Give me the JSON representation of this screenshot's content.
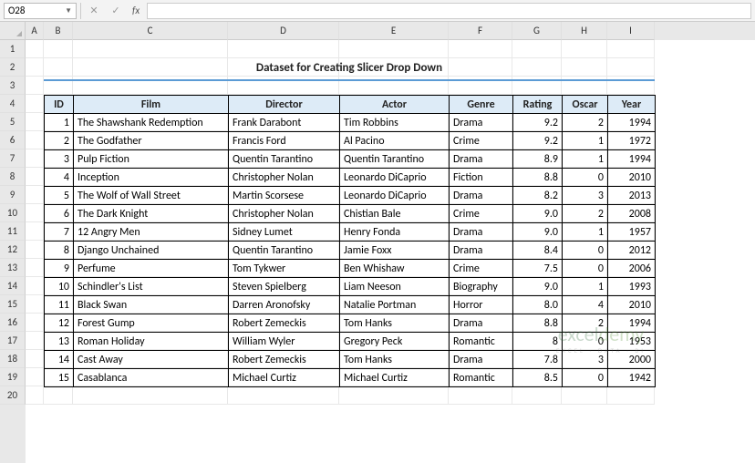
{
  "nameBox": {
    "value": "O28"
  },
  "formulaBar": {
    "value": ""
  },
  "title": "Dataset for Creating Slicer Drop Down",
  "columns": [
    "A",
    "B",
    "C",
    "D",
    "E",
    "F",
    "G",
    "H",
    "I"
  ],
  "rows": [
    1,
    2,
    3,
    4,
    5,
    6,
    7,
    8,
    9,
    10,
    11,
    12,
    13,
    14,
    15,
    16,
    17,
    18,
    19,
    20
  ],
  "headers": {
    "id": "ID",
    "film": "Film",
    "director": "Director",
    "actor": "Actor",
    "genre": "Genre",
    "rating": "Rating",
    "oscar": "Oscar",
    "year": "Year"
  },
  "chart_data": {
    "type": "table",
    "title": "Dataset for Creating Slicer Drop Down",
    "columns": [
      "ID",
      "Film",
      "Director",
      "Actor",
      "Genre",
      "Rating",
      "Oscar",
      "Year"
    ],
    "rows": [
      {
        "id": "1",
        "film": "The Shawshank Redemption",
        "director": "Frank Darabont",
        "actor": "Tim Robbins",
        "genre": "Drama",
        "rating": "9.2",
        "oscar": "2",
        "year": "1994"
      },
      {
        "id": "2",
        "film": "The Godfather",
        "director": "Francis Ford",
        "actor": "Al Pacino",
        "genre": "Crime",
        "rating": "9.2",
        "oscar": "1",
        "year": "1972"
      },
      {
        "id": "3",
        "film": "Pulp Fiction",
        "director": "Quentin Tarantino",
        "actor": "Quentin Tarantino",
        "genre": "Drama",
        "rating": "8.9",
        "oscar": "1",
        "year": "1994"
      },
      {
        "id": "4",
        "film": "Inception",
        "director": "Christopher Nolan",
        "actor": "Leonardo DiCaprio",
        "genre": "Fiction",
        "rating": "8.8",
        "oscar": "0",
        "year": "2010"
      },
      {
        "id": "5",
        "film": "The Wolf of Wall Street",
        "director": "Martin Scorsese",
        "actor": "Leonardo DiCaprio",
        "genre": "Drama",
        "rating": "8.2",
        "oscar": "3",
        "year": "2013"
      },
      {
        "id": "6",
        "film": "The Dark Knight",
        "director": "Christopher Nolan",
        "actor": "Chistian Bale",
        "genre": "Crime",
        "rating": "9.0",
        "oscar": "2",
        "year": "2008"
      },
      {
        "id": "7",
        "film": "12 Angry Men",
        "director": "Sidney Lumet",
        "actor": "Henry Fonda",
        "genre": "Drama",
        "rating": "9.0",
        "oscar": "1",
        "year": "1957"
      },
      {
        "id": "8",
        "film": "Django Unchained",
        "director": "Quentin Tarantino",
        "actor": "Jamie Foxx",
        "genre": "Drama",
        "rating": "8.4",
        "oscar": "0",
        "year": "2012"
      },
      {
        "id": "9",
        "film": "Perfume",
        "director": "Tom Tykwer",
        "actor": "Ben Whishaw",
        "genre": "Crime",
        "rating": "7.5",
        "oscar": "0",
        "year": "2006"
      },
      {
        "id": "10",
        "film": "Schindler's List",
        "director": "Steven Spielberg",
        "actor": "Liam Neeson",
        "genre": "Biography",
        "rating": "9.0",
        "oscar": "1",
        "year": "1993"
      },
      {
        "id": "11",
        "film": "Black Swan",
        "director": "Darren Aronofsky",
        "actor": "Natalie Portman",
        "genre": "Horror",
        "rating": "8.0",
        "oscar": "4",
        "year": "2010"
      },
      {
        "id": "12",
        "film": "Forest Gump",
        "director": "Robert Zemeckis",
        "actor": "Tom Hanks",
        "genre": "Drama",
        "rating": "8.8",
        "oscar": "2",
        "year": "1994"
      },
      {
        "id": "13",
        "film": "Roman Holiday",
        "director": "William Wyler",
        "actor": "Gregory Peck",
        "genre": "Romantic",
        "rating": "8",
        "oscar": "0",
        "year": "1953"
      },
      {
        "id": "14",
        "film": "Cast Away",
        "director": "Robert Zemeckis",
        "actor": "Tom Hanks",
        "genre": "Drama",
        "rating": "7.8",
        "oscar": "3",
        "year": "2000"
      },
      {
        "id": "15",
        "film": "Casablanca",
        "director": "Michael Curtiz",
        "actor": "Michael Curtiz",
        "genre": "Romantic",
        "rating": "8.5",
        "oscar": "0",
        "year": "1942"
      }
    ]
  },
  "watermark": {
    "line1a": "excel",
    "line1b": "demy",
    "line2": "EXCEL · DATA · BI"
  }
}
